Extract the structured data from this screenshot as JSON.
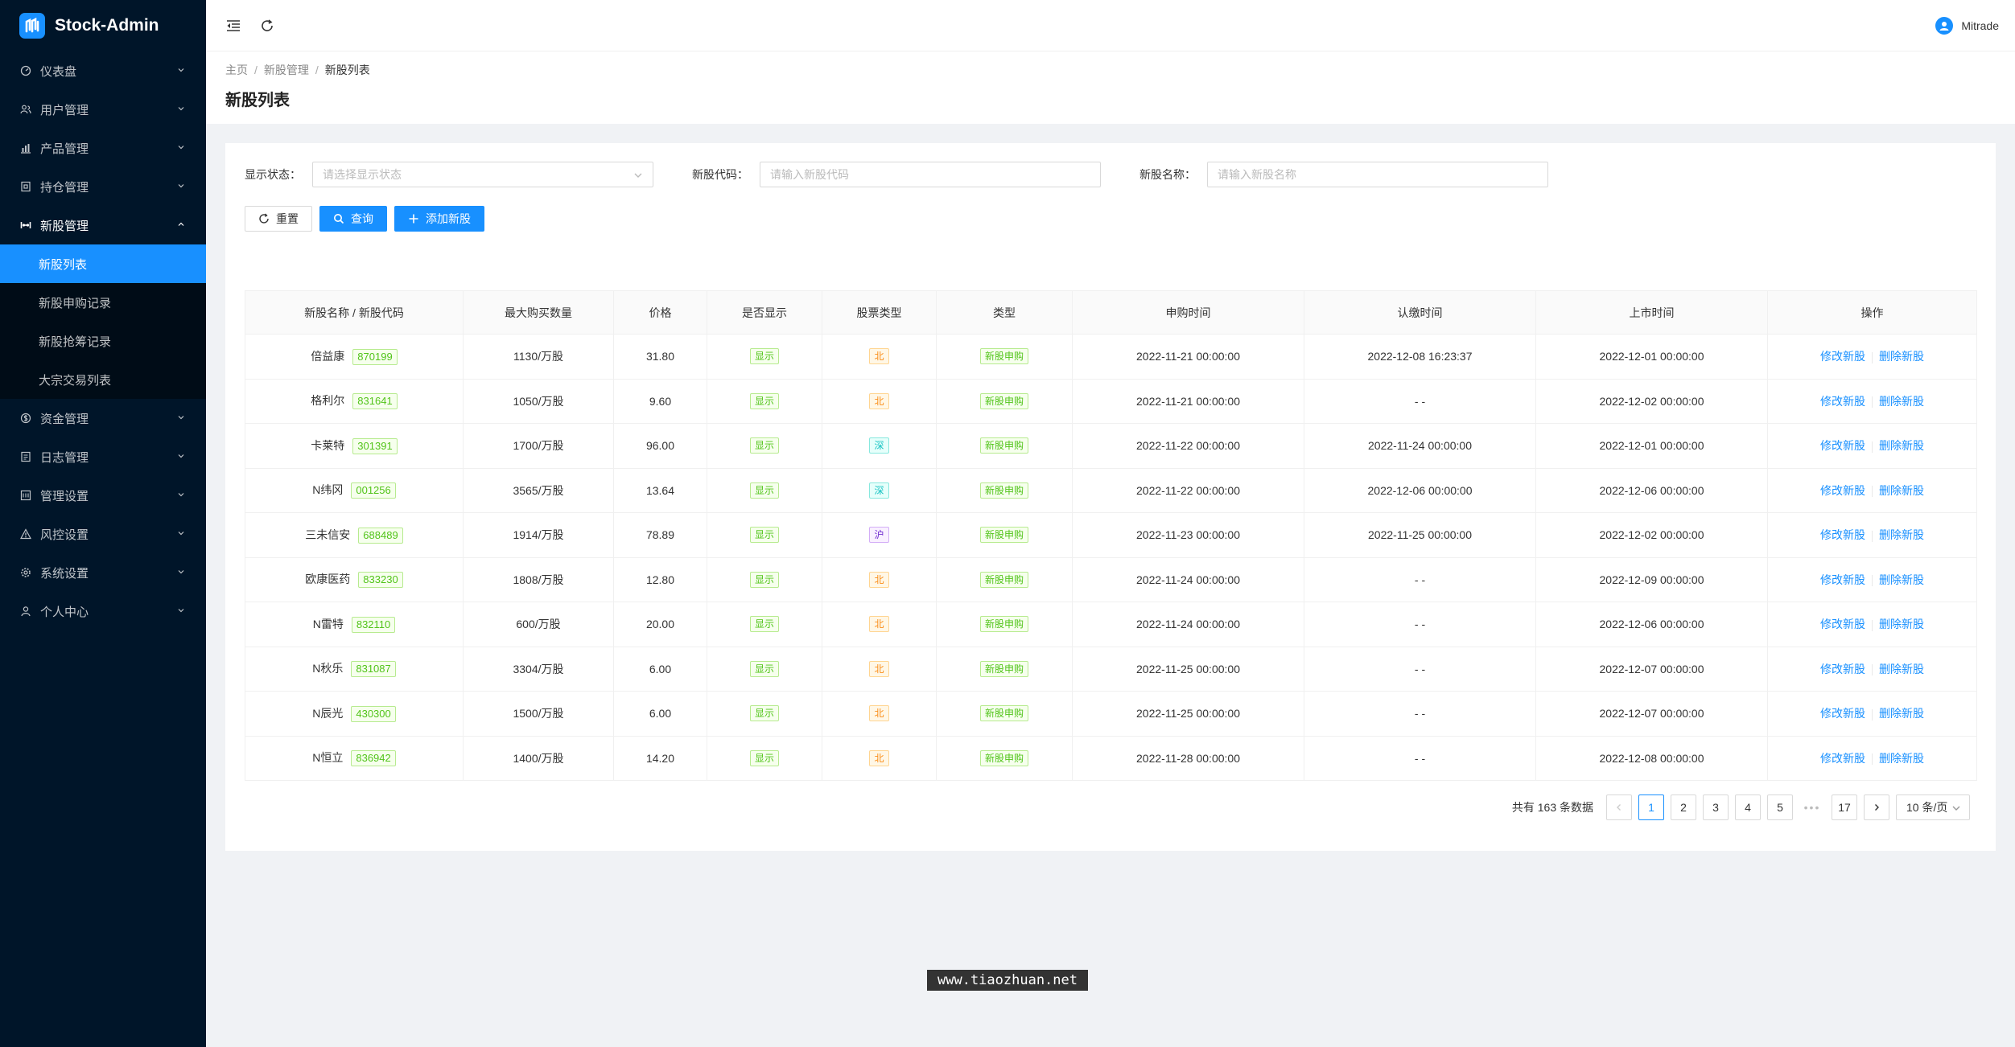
{
  "app": {
    "title": "Stock-Admin"
  },
  "sidebar": {
    "items": [
      {
        "label": "仪表盘",
        "icon": "dashboard-icon",
        "name": "sidebar-item-dashboard"
      },
      {
        "label": "用户管理",
        "icon": "users-icon",
        "name": "sidebar-item-users"
      },
      {
        "label": "产品管理",
        "icon": "chart-icon",
        "name": "sidebar-item-products"
      },
      {
        "label": "持仓管理",
        "icon": "holdings-icon",
        "name": "sidebar-item-holdings"
      },
      {
        "label": "新股管理",
        "icon": "new-stock-icon",
        "name": "sidebar-item-new-stock",
        "open": true,
        "children": [
          {
            "label": "新股列表",
            "active": true,
            "name": "sidebar-sub-new-stock-list"
          },
          {
            "label": "新股申购记录",
            "name": "sidebar-sub-subscription-records"
          },
          {
            "label": "新股抢筹记录",
            "name": "sidebar-sub-grab-records"
          },
          {
            "label": "大宗交易列表",
            "name": "sidebar-sub-block-trade-list"
          }
        ]
      },
      {
        "label": "资金管理",
        "icon": "funds-icon",
        "name": "sidebar-item-funds"
      },
      {
        "label": "日志管理",
        "icon": "log-icon",
        "name": "sidebar-item-logs"
      },
      {
        "label": "管理设置",
        "icon": "admin-settings-icon",
        "name": "sidebar-item-admin-settings"
      },
      {
        "label": "风控设置",
        "icon": "risk-icon",
        "name": "sidebar-item-risk"
      },
      {
        "label": "系统设置",
        "icon": "gear-icon",
        "name": "sidebar-item-system"
      },
      {
        "label": "个人中心",
        "icon": "user-icon",
        "name": "sidebar-item-profile"
      }
    ]
  },
  "header": {
    "user_name": "Mitrade"
  },
  "breadcrumb": [
    "主页",
    "新股管理",
    "新股列表"
  ],
  "page_title": "新股列表",
  "filters": {
    "status_label": "显示状态：",
    "status_placeholder": "请选择显示状态",
    "code_label": "新股代码：",
    "code_placeholder": "请输入新股代码",
    "name_label": "新股名称：",
    "name_placeholder": "请输入新股名称"
  },
  "buttons": {
    "reset": "重置",
    "query": "查询",
    "add": "添加新股"
  },
  "table": {
    "columns": [
      "新股名称 / 新股代码",
      "最大购买数量",
      "价格",
      "是否显示",
      "股票类型",
      "类型",
      "申购时间",
      "认缴时间",
      "上市时间",
      "操作"
    ],
    "edit_label": "修改新股",
    "delete_label": "删除新股",
    "rows": [
      {
        "name": "倍益康",
        "code": "870199",
        "max": "1130/万股",
        "price": "31.80",
        "show": "显示",
        "stype": "北",
        "stype_color": "orange",
        "type": "新股申购",
        "sub_time": "2022-11-21 00:00:00",
        "pay_time": "2022-12-08 16:23:37",
        "list_time": "2022-12-01 00:00:00"
      },
      {
        "name": "格利尔",
        "code": "831641",
        "max": "1050/万股",
        "price": "9.60",
        "show": "显示",
        "stype": "北",
        "stype_color": "orange",
        "type": "新股申购",
        "sub_time": "2022-11-21 00:00:00",
        "pay_time": "- -",
        "list_time": "2022-12-02 00:00:00"
      },
      {
        "name": "卡莱特",
        "code": "301391",
        "max": "1700/万股",
        "price": "96.00",
        "show": "显示",
        "stype": "深",
        "stype_color": "cyan",
        "type": "新股申购",
        "sub_time": "2022-11-22 00:00:00",
        "pay_time": "2022-11-24 00:00:00",
        "list_time": "2022-12-01 00:00:00"
      },
      {
        "name": "N纬冈",
        "code": "001256",
        "max": "3565/万股",
        "price": "13.64",
        "show": "显示",
        "stype": "深",
        "stype_color": "cyan",
        "type": "新股申购",
        "sub_time": "2022-11-22 00:00:00",
        "pay_time": "2022-12-06 00:00:00",
        "list_time": "2022-12-06 00:00:00"
      },
      {
        "name": "三未信安",
        "code": "688489",
        "max": "1914/万股",
        "price": "78.89",
        "show": "显示",
        "stype": "沪",
        "stype_color": "purple",
        "type": "新股申购",
        "sub_time": "2022-11-23 00:00:00",
        "pay_time": "2022-11-25 00:00:00",
        "list_time": "2022-12-02 00:00:00"
      },
      {
        "name": "欧康医药",
        "code": "833230",
        "max": "1808/万股",
        "price": "12.80",
        "show": "显示",
        "stype": "北",
        "stype_color": "orange",
        "type": "新股申购",
        "sub_time": "2022-11-24 00:00:00",
        "pay_time": "- -",
        "list_time": "2022-12-09 00:00:00"
      },
      {
        "name": "N雷特",
        "code": "832110",
        "max": "600/万股",
        "price": "20.00",
        "show": "显示",
        "stype": "北",
        "stype_color": "orange",
        "type": "新股申购",
        "sub_time": "2022-11-24 00:00:00",
        "pay_time": "- -",
        "list_time": "2022-12-06 00:00:00"
      },
      {
        "name": "N秋乐",
        "code": "831087",
        "max": "3304/万股",
        "price": "6.00",
        "show": "显示",
        "stype": "北",
        "stype_color": "orange",
        "type": "新股申购",
        "sub_time": "2022-11-25 00:00:00",
        "pay_time": "- -",
        "list_time": "2022-12-07 00:00:00"
      },
      {
        "name": "N辰光",
        "code": "430300",
        "max": "1500/万股",
        "price": "6.00",
        "show": "显示",
        "stype": "北",
        "stype_color": "orange",
        "type": "新股申购",
        "sub_time": "2022-11-25 00:00:00",
        "pay_time": "- -",
        "list_time": "2022-12-07 00:00:00"
      },
      {
        "name": "N恒立",
        "code": "836942",
        "max": "1400/万股",
        "price": "14.20",
        "show": "显示",
        "stype": "北",
        "stype_color": "orange",
        "type": "新股申购",
        "sub_time": "2022-11-28 00:00:00",
        "pay_time": "- -",
        "list_time": "2022-12-08 00:00:00"
      }
    ]
  },
  "pagination": {
    "total_text": "共有 163 条数据",
    "pages": [
      "1",
      "2",
      "3",
      "4",
      "5"
    ],
    "current": "1",
    "ellipsis": "•••",
    "last": "17",
    "page_size": "10 条/页"
  },
  "watermark": "www.tiaozhuan.net",
  "colors": {
    "accent": "#1890ff",
    "sidebar_bg": "#001529"
  }
}
